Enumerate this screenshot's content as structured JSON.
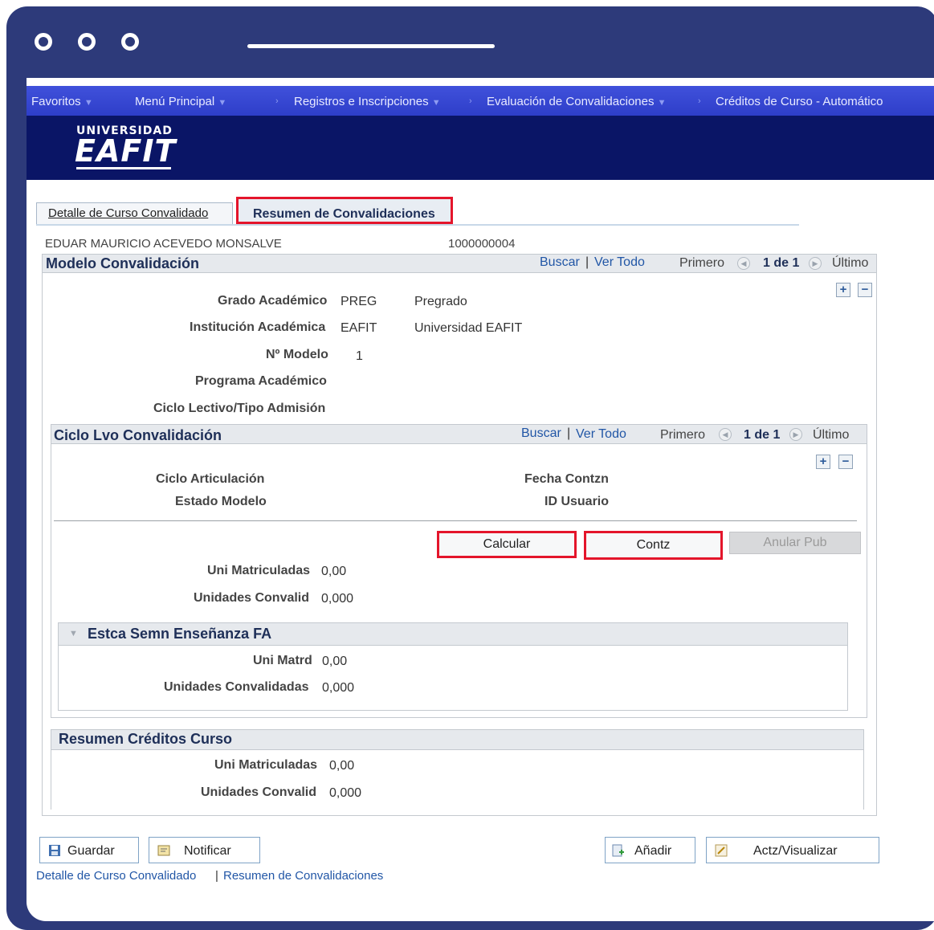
{
  "nav": {
    "favoritos": "Favoritos",
    "menu_principal": "Menú Principal",
    "crumb1": "Registros e Inscripciones",
    "crumb2": "Evaluación de Convalidaciones",
    "crumb3": "Créditos de Curso - Automático"
  },
  "logo": {
    "top": "UNIVERSIDAD",
    "main": "EAFIT"
  },
  "tabs": [
    {
      "label": "Detalle de Curso Convalidado"
    },
    {
      "label": "Resumen de Convalidaciones"
    }
  ],
  "student": {
    "name": "EDUAR MAURICIO ACEVEDO MONSALVE",
    "id": "1000000004"
  },
  "modelo": {
    "title": "Modelo Convalidación",
    "buscar": "Buscar",
    "separator": "|",
    "ver_todo": "Ver Todo",
    "primero": "Primero",
    "pager": "1 de 1",
    "ultimo": "Último",
    "grado_label": "Grado Académico",
    "grado_code": "PREG",
    "grado_desc": "Pregrado",
    "inst_label": "Institución Académica",
    "inst_code": "EAFIT",
    "inst_desc": "Universidad EAFIT",
    "modelo_label": "Nº Modelo",
    "modelo_value": "1",
    "programa_label": "Programa Académico",
    "ciclo_label": "Ciclo Lectivo/Tipo Admisión"
  },
  "ciclo": {
    "title": "Ciclo Lvo Convalidación",
    "buscar": "Buscar",
    "separator": "|",
    "ver_todo": "Ver Todo",
    "primero": "Primero",
    "pager": "1 de 1",
    "ultimo": "Último",
    "articulacion_label": "Ciclo Articulación",
    "estado_label": "Estado Modelo",
    "fecha_label": "Fecha Contzn",
    "usuario_label": "ID Usuario",
    "btn_calcular": "Calcular",
    "btn_contz": "Contz",
    "btn_anular": "Anular Pub",
    "uni_mat_label": "Uni Matriculadas",
    "uni_mat_value": "0,00",
    "uni_conv_label": "Unidades Convalid",
    "uni_conv_value": "0,000"
  },
  "estca": {
    "title": "Estca Semn Enseñanza FA",
    "uni_matrd_label": "Uni Matrd",
    "uni_matrd_value": "0,00",
    "unidades_label": "Unidades Convalidadas",
    "unidades_value": "0,000"
  },
  "resumen": {
    "title": "Resumen Créditos Curso",
    "uni_mat_label": "Uni Matriculadas",
    "uni_mat_value": "0,00",
    "uni_conv_label": "Unidades Convalid",
    "uni_conv_value": "0,000"
  },
  "footer": {
    "guardar": "Guardar",
    "notificar": "Notificar",
    "anadir": "Añadir",
    "actualizar": "Actz/Visualizar",
    "link1": "Detalle de Curso Convalidado",
    "link_sep": "|",
    "link2": "Resumen de Convalidaciones"
  }
}
